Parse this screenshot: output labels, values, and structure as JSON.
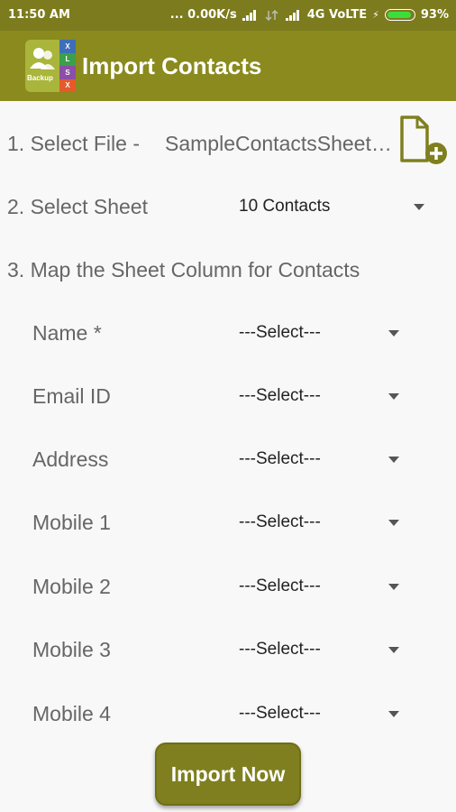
{
  "status_bar": {
    "time": "11:50 AM",
    "speed": "... 0.00K/s",
    "network": "4G VoLTE",
    "battery": "93%",
    "battery_level": 0.93
  },
  "app_bar": {
    "title": "Import Contacts",
    "logo_text": "Backup",
    "logo_letters": [
      "X",
      "L",
      "S",
      "X"
    ],
    "color": "#8a8a1e"
  },
  "form": {
    "step1_label": "1. Select File  -",
    "file_name": "SampleContactsSheet.xlsx",
    "step2_label": "2. Select Sheet",
    "sheet_value": "10 Contacts",
    "step3_label": "3. Map the Sheet Column for Contacts",
    "fields": [
      {
        "label": "Name *",
        "value": "---Select---"
      },
      {
        "label": "Email ID",
        "value": "---Select---"
      },
      {
        "label": "Address",
        "value": "---Select---"
      },
      {
        "label": "Mobile 1",
        "value": "---Select---"
      },
      {
        "label": "Mobile 2",
        "value": "---Select---"
      },
      {
        "label": "Mobile 3",
        "value": "---Select---"
      },
      {
        "label": "Mobile 4",
        "value": "---Select---"
      }
    ]
  },
  "import_button": "Import Now",
  "icons": {
    "file_add": "file-add-icon",
    "dropdown": "chevron-down-icon"
  }
}
